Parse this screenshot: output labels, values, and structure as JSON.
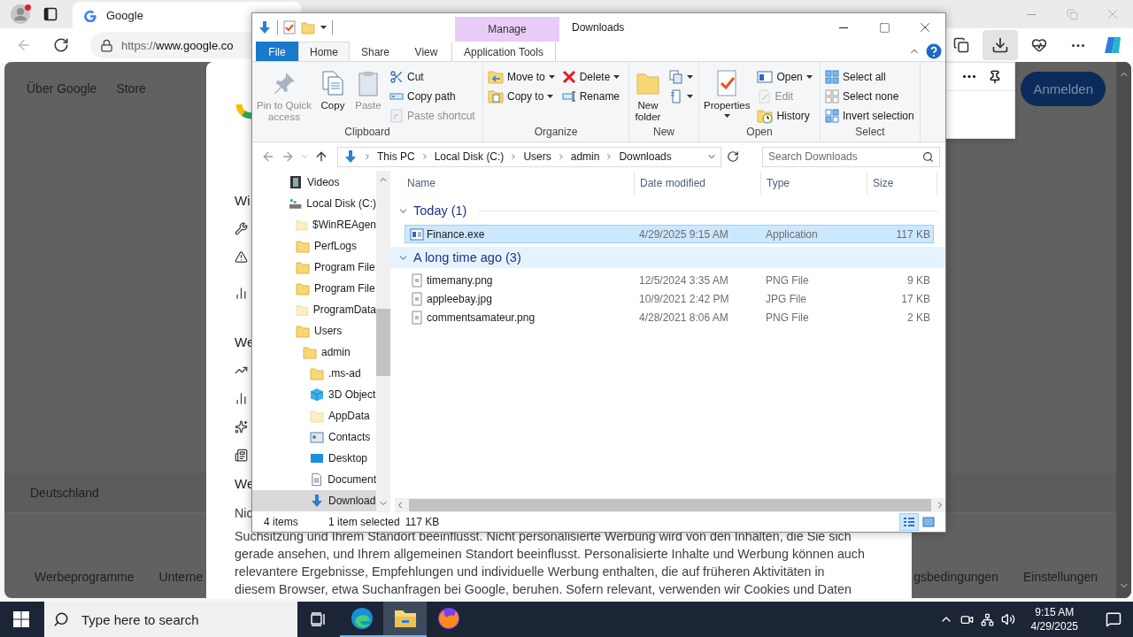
{
  "browser": {
    "tab": {
      "title": "Google",
      "selected": true
    },
    "address": {
      "scheme": "https://",
      "host": "www.google.co"
    },
    "page": {
      "header_links": [
        "Über Google",
        "Store"
      ],
      "sign_in": "Anmelden",
      "country": "Deutschland",
      "footer_left": [
        "Werbeprogramme",
        "Unterne"
      ],
      "footer_right": [
        "gsbedingungen",
        "Einstellungen"
      ]
    },
    "dialog": {
      "sections": [
        {
          "heading": "Wi"
        },
        {
          "heading": "We"
        },
        {
          "heading": "We"
        }
      ],
      "paragraph_start": "Nic",
      "paragraph": [
        "Suchsitzung und Ihrem Standort beeinflusst. Nicht personalisierte Werbung wird von den Inhalten, die Sie sich",
        "gerade ansehen, und Ihrem allgemeinen Standort beeinflusst. Personalisierte Inhalte und Werbung können auch",
        "relevantere Ergebnisse, Empfehlungen und individuelle Werbung enthalten, die auf früheren Aktivitäten in",
        "diesem Browser, etwa Suchanfragen bei Google, beruhen. Sofern relevant, verwenden wir Cookies und Daten"
      ]
    }
  },
  "explorer": {
    "title": "Downloads",
    "context_tab": "Manage",
    "tabs": [
      {
        "label": "File",
        "kind": "file",
        "selected": false
      },
      {
        "label": "Home",
        "kind": "tab",
        "selected": true
      },
      {
        "label": "Share",
        "kind": "tab",
        "selected": false
      },
      {
        "label": "View",
        "kind": "tab",
        "selected": false
      },
      {
        "label": "Application Tools",
        "kind": "context",
        "selected": false
      }
    ],
    "ribbon": [
      {
        "label": "Clipboard",
        "items": [
          {
            "kind": "large",
            "label": "Pin to Quick\naccess",
            "disabled": true,
            "dropdown": false
          },
          {
            "kind": "large",
            "label": "Copy",
            "disabled": false,
            "dropdown": false
          },
          {
            "kind": "large",
            "label": "Paste",
            "disabled": true,
            "dropdown": false
          },
          {
            "kind": "stack",
            "buttons": [
              {
                "label": "Cut",
                "disabled": false,
                "dropdown": false
              },
              {
                "label": "Copy path",
                "disabled": false,
                "dropdown": false
              },
              {
                "label": "Paste shortcut",
                "disabled": true,
                "dropdown": false
              }
            ]
          }
        ]
      },
      {
        "label": "Organize",
        "items": [
          {
            "kind": "stack",
            "buttons": [
              {
                "label": "Move to",
                "disabled": false,
                "dropdown": true
              },
              {
                "label": "Copy to",
                "disabled": false,
                "dropdown": true
              }
            ]
          },
          {
            "kind": "stack",
            "buttons": [
              {
                "label": "Delete",
                "disabled": false,
                "dropdown": true
              },
              {
                "label": "Rename",
                "disabled": false,
                "dropdown": false
              }
            ]
          }
        ]
      },
      {
        "label": "New",
        "items": [
          {
            "kind": "large",
            "label": "New\nfolder",
            "disabled": false,
            "dropdown": false
          },
          {
            "kind": "stack",
            "buttons": [
              {
                "disabled": false,
                "dropdown": true
              },
              {
                "disabled": false,
                "dropdown": true
              }
            ]
          }
        ]
      },
      {
        "label": "Open",
        "items": [
          {
            "kind": "large",
            "label": "Properties",
            "disabled": false,
            "dropdown": true
          },
          {
            "kind": "stack",
            "buttons": [
              {
                "label": "Open",
                "disabled": false,
                "dropdown": true
              },
              {
                "label": "Edit",
                "disabled": true,
                "dropdown": false
              },
              {
                "label": "History",
                "disabled": false,
                "dropdown": false
              }
            ]
          }
        ]
      },
      {
        "label": "Select",
        "items": [
          {
            "kind": "stack",
            "buttons": [
              {
                "label": "Select all",
                "disabled": false,
                "dropdown": false
              },
              {
                "label": "Select none",
                "disabled": false,
                "dropdown": false
              },
              {
                "label": "Invert selection",
                "disabled": false,
                "dropdown": false
              }
            ]
          }
        ]
      }
    ],
    "crumbs": [
      "This PC",
      "Local Disk (C:)",
      "Users",
      "admin",
      "Downloads"
    ],
    "search": {
      "placeholder": "Search Downloads"
    },
    "nav": [
      {
        "label": "Videos",
        "kind": "videos",
        "selected": false
      },
      {
        "label": "Local Disk (C:)",
        "kind": "drive",
        "selected": false,
        "children": [
          {
            "label": "$WinREAgen",
            "kind": "hidden-folder",
            "selected": false
          },
          {
            "label": "PerfLogs",
            "kind": "folder",
            "selected": false
          },
          {
            "label": "Program File",
            "kind": "folder",
            "selected": false
          },
          {
            "label": "Program File",
            "kind": "folder",
            "selected": false
          },
          {
            "label": "ProgramData",
            "kind": "hidden-folder",
            "selected": false
          },
          {
            "label": "Users",
            "kind": "folder",
            "selected": false,
            "children": [
              {
                "label": "admin",
                "kind": "folder",
                "selected": false,
                "children": [
                  {
                    "label": ".ms-ad",
                    "kind": "folder",
                    "selected": false
                  },
                  {
                    "label": "3D Object",
                    "kind": "cube",
                    "selected": false
                  },
                  {
                    "label": "AppData",
                    "kind": "hidden-folder",
                    "selected": false
                  },
                  {
                    "label": "Contacts",
                    "kind": "contacts",
                    "selected": false
                  },
                  {
                    "label": "Desktop",
                    "kind": "desktop",
                    "selected": false
                  },
                  {
                    "label": "Document",
                    "kind": "documents",
                    "selected": false
                  },
                  {
                    "label": "Download",
                    "kind": "downloads",
                    "selected": true
                  }
                ]
              }
            ]
          }
        ]
      }
    ],
    "columns": [
      "Name",
      "Date modified",
      "Type",
      "Size"
    ],
    "groups": [
      {
        "label": "Today (1)",
        "expanded": true,
        "highlighted": false,
        "rows": [
          {
            "name": "Finance.exe",
            "kind": "app",
            "date": "4/29/2025 9:15 AM",
            "type": "Application",
            "size": "117 KB",
            "selected": true
          }
        ]
      },
      {
        "label": "A long time ago (3)",
        "expanded": true,
        "highlighted": true,
        "rows": [
          {
            "name": "timemany.png",
            "kind": "image",
            "date": "12/5/2024 3:35 AM",
            "type": "PNG File",
            "size": "9 KB",
            "selected": false
          },
          {
            "name": "appleebay.jpg",
            "kind": "image",
            "date": "10/9/2021 2:42 PM",
            "type": "JPG File",
            "size": "17 KB",
            "selected": false
          },
          {
            "name": "commentsamateur.png",
            "kind": "image",
            "date": "4/28/2021 8:06 AM",
            "type": "PNG File",
            "size": "2 KB",
            "selected": false
          }
        ]
      }
    ],
    "status": {
      "count": "4 items",
      "selection": "1 item selected",
      "size": "117 KB"
    },
    "views": [
      {
        "selected": true
      },
      {
        "selected": false
      }
    ]
  },
  "taskbar": {
    "search_placeholder": "Type here to search",
    "apps": [
      {
        "running": true,
        "selected": false
      },
      {
        "running": true,
        "selected": true
      },
      {
        "running": false,
        "selected": false
      }
    ],
    "time": "9:15 AM",
    "date": "4/29/2025"
  }
}
